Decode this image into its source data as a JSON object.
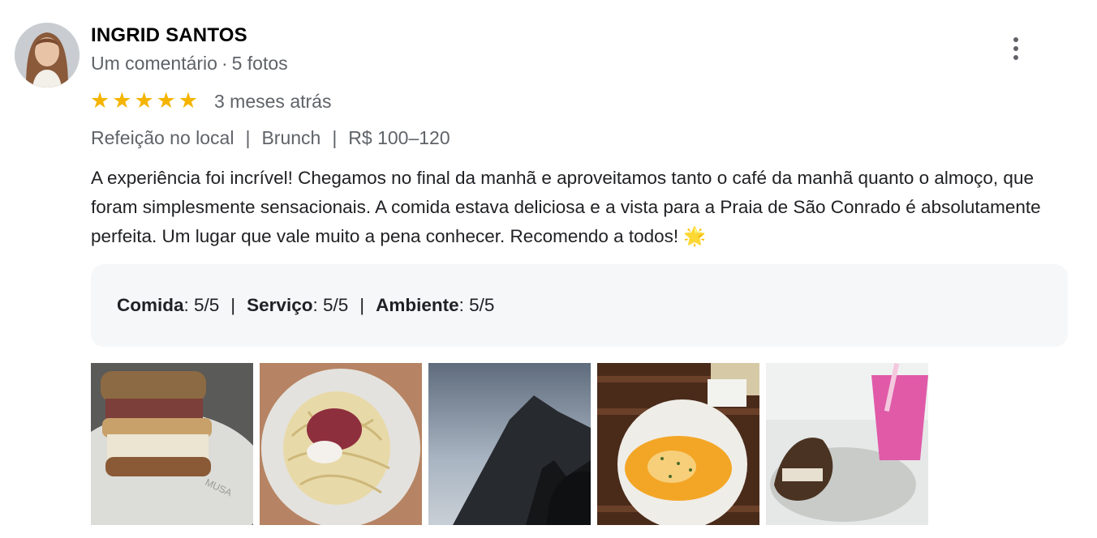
{
  "review": {
    "author": "INGRID SANTOS",
    "comments": "Um comentário",
    "dot": "·",
    "photos_count": "5 fotos",
    "rating": 5,
    "star_glyph": "★",
    "time_ago": "3 meses atrás",
    "attributes": [
      "Refeição no local",
      "Brunch",
      "R$ 100–120"
    ],
    "attr_separator": "|",
    "text": "A experiência foi incrível! Chegamos no final da manhã e aproveitamos tanto o café da manhã quanto o almoço, que foram simplesmente sensacionais. A comida estava deliciosa e a vista para a Praia de São Conrado é absolutamente perfeita. Um lugar que vale muito a pena conhecer. Recomendo a todos! 🌟",
    "sub_ratings": [
      {
        "label": "Comida",
        "value": ": 5/5"
      },
      {
        "label": "Serviço",
        "value": ": 5/5"
      },
      {
        "label": "Ambiente",
        "value": ": 5/5"
      }
    ],
    "photos": [
      "sandwich-photo",
      "pasta-photo",
      "mountain-photo",
      "eggs-photo",
      "drink-photo"
    ],
    "photo_logo_text": "MUSA"
  },
  "colors": {
    "star": "#f4b400",
    "meta": "#5f6368",
    "box_bg": "#f6f7f9"
  },
  "icons": {
    "more": "more-vert-icon",
    "star": "star-icon"
  }
}
